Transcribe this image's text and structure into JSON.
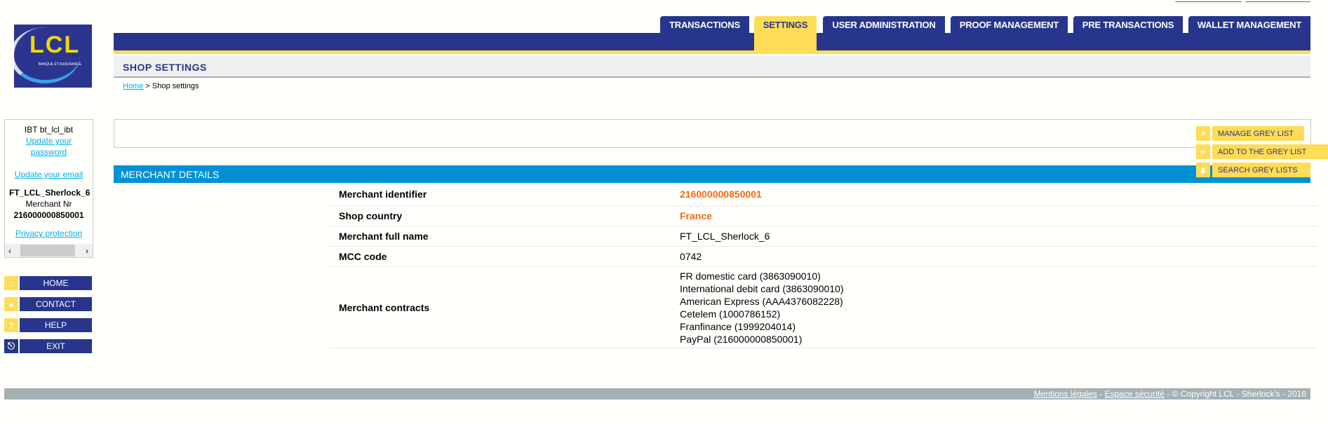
{
  "logo": {
    "text": "LCL",
    "subtitle": "BANQUE ET ASSURANCE"
  },
  "tabs": [
    {
      "label": "TRANSACTIONS"
    },
    {
      "label": "SETTINGS",
      "active": true
    },
    {
      "label": "USER ADMINISTRATION"
    },
    {
      "label": "PROOF MANAGEMENT"
    },
    {
      "label": "PRE TRANSACTIONS"
    },
    {
      "label": "WALLET MANAGEMENT"
    }
  ],
  "page_title": "SHOP SETTINGS",
  "breadcrumb": {
    "home": "Home",
    "separator": " > ",
    "current": "Shop settings"
  },
  "user": {
    "login": "IBT bt_lcl_ibt",
    "update_password": "Update your password",
    "update_email": "Update your email",
    "shop_name": "FT_LCL_Sherlock_6",
    "merchant_label": "Merchant Nr",
    "merchant_nr": "216000000850001",
    "privacy": "Privacy protection"
  },
  "nav": [
    {
      "label": "HOME",
      "icon": "home-icon"
    },
    {
      "label": "CONTACT",
      "icon": "speech-bubble-icon"
    },
    {
      "label": "HELP",
      "icon": "question-icon"
    },
    {
      "label": "EXIT",
      "icon": "power-icon"
    }
  ],
  "grey_list": [
    {
      "label": "MANAGE GREY LIST",
      "icon": "gear-icon"
    },
    {
      "label": "ADD TO THE GREY LIST",
      "icon": "gear-icon"
    },
    {
      "label": "SEARCH GREY LISTS",
      "icon": "walker-icon"
    }
  ],
  "section_title": "MERCHANT DETAILS",
  "details": [
    {
      "label": "Merchant identifier",
      "value": "216000000850001",
      "highlight": true
    },
    {
      "label": "Shop country",
      "value": "France",
      "highlight": true
    },
    {
      "label": "Merchant full name",
      "value": "FT_LCL_Sherlock_6"
    },
    {
      "label": "MCC code",
      "value": "0742"
    }
  ],
  "contracts": {
    "label": "Merchant contracts",
    "items": [
      "FR domestic card (3863090010)",
      "International debit card (3863090010)",
      "American Express (AAA4376082228)",
      "Cetelem (1000786152)",
      "Franfinance (1999204014)",
      "PayPal (216000000850001)"
    ]
  },
  "footer": {
    "legal": "Mentions légales",
    "sep": " - ",
    "security": "Espace sécurité",
    "copyright": " - © Copyright LCL - Sherlock's - 2016"
  },
  "colors": {
    "navy": "#27368c",
    "yellow": "#ffdc55",
    "blue": "#0091d5",
    "orange": "#f26a10",
    "grey": "#a4b0b2"
  }
}
